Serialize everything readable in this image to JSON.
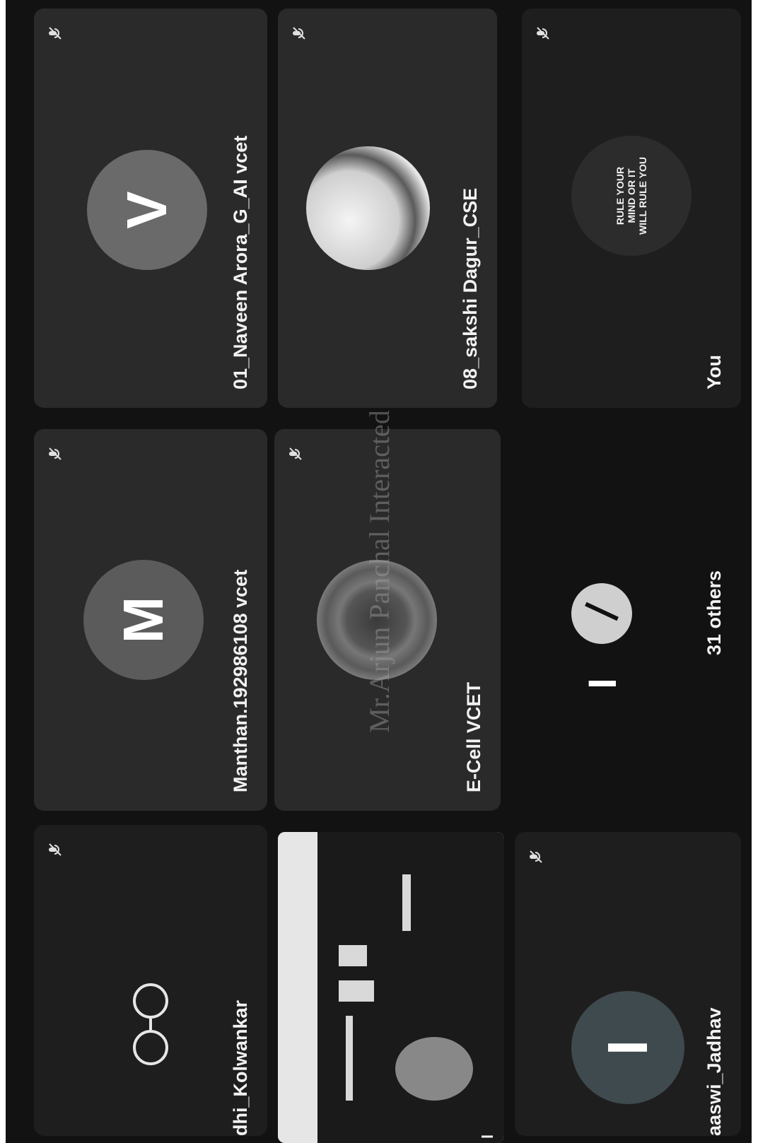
{
  "watermark": "Mr.Arjun Panchal Interacted",
  "participants": [
    {
      "name": "dhi_Kolwankar",
      "avatar": "glasses-icon"
    },
    {
      "name": "Manthan.192986108 vcet",
      "avatar_letter": "M",
      "avatar_color": "#5b5b5b"
    },
    {
      "name": "01_Naveen Arora_G_AI vcet",
      "avatar_letter": "V",
      "avatar_color": "#6a6a6a"
    },
    {
      "name": "l",
      "avatar": "screen-share-thumbnail"
    },
    {
      "name": "E-Cell VCET",
      "avatar": "logo-photo"
    },
    {
      "name": "08_sakshi Dagur_CSE",
      "avatar": "profile-photo"
    },
    {
      "name": "aaswi_Jadhav",
      "avatar_letter": "I",
      "avatar_color": "#3f4a4e"
    },
    {
      "name": "31 others",
      "avatar_letter": "I"
    },
    {
      "name": "You",
      "avatar_text": [
        "RULE YOUR",
        "MIND OR IT",
        "WILL RULE YOU"
      ]
    }
  ],
  "icons": {
    "mic": "mic-off-icon"
  }
}
